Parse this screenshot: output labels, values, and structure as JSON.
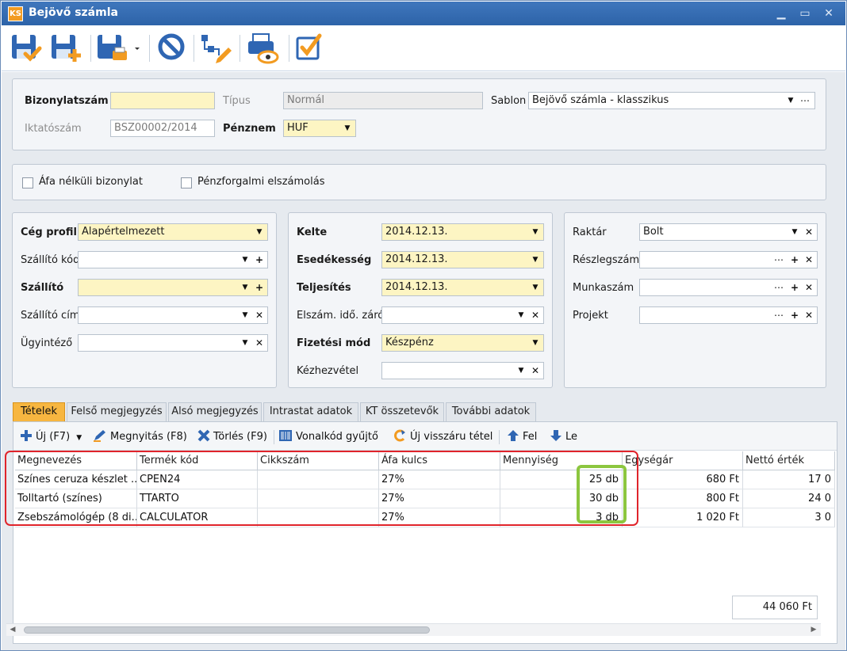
{
  "window": {
    "title": "Bejövő számla",
    "logo": "KS"
  },
  "toolbar": {
    "icons": [
      "save-check-icon",
      "save-new-icon",
      "save-print-icon",
      "cancel-icon",
      "workflow-icon",
      "print-preview-icon",
      "approve-icon"
    ]
  },
  "header": {
    "bizonylatszam": {
      "label": "Bizonylatszám",
      "value": ""
    },
    "tipus": {
      "label": "Típus",
      "value": "Normál"
    },
    "sablon": {
      "label": "Sablon",
      "value": "Bejövő számla - klasszikus"
    },
    "iktatoszam": {
      "label": "Iktatószám",
      "value": "BSZ00002/2014"
    },
    "penznem": {
      "label": "Pénznem",
      "value": "HUF"
    }
  },
  "options": {
    "afa_nelkuli": {
      "label": "Áfa nélküli bizonylat",
      "checked": false
    },
    "penzforgalmi": {
      "label": "Pénzforgalmi elszámolás",
      "checked": false
    }
  },
  "left": {
    "ceg_profil": {
      "label": "Cég profil",
      "value": "Alapértelmezett"
    },
    "szallito_kod": {
      "label": "Szállító kód",
      "value": ""
    },
    "szallito": {
      "label": "Szállító",
      "value": ""
    },
    "szallito_cim": {
      "label": "Szállító cím",
      "value": ""
    },
    "ugyintezo": {
      "label": "Ügyintéző",
      "value": ""
    }
  },
  "middle": {
    "kelte": {
      "label": "Kelte",
      "value": "2014.12.13."
    },
    "esedekesseg": {
      "label": "Esedékesség",
      "value": "2014.12.13."
    },
    "teljesites": {
      "label": "Teljesítés",
      "value": "2014.12.13."
    },
    "elszam": {
      "label": "Elszám. idő. záró",
      "value": ""
    },
    "fizetesi_mod": {
      "label": "Fizetési mód",
      "value": "Készpénz"
    },
    "kezhezvetel": {
      "label": "Kézhezvétel",
      "value": ""
    }
  },
  "right": {
    "raktar": {
      "label": "Raktár",
      "value": "Bolt"
    },
    "reszlegszam": {
      "label": "Részlegszám",
      "value": ""
    },
    "munkaszam": {
      "label": "Munkaszám",
      "value": ""
    },
    "projekt": {
      "label": "Projekt",
      "value": ""
    }
  },
  "tabs": [
    "Tételek",
    "Felső megjegyzés",
    "Alsó megjegyzés",
    "Intrastat adatok",
    "KT összetevők",
    "További adatok"
  ],
  "grid_toolbar": {
    "new": "Új (F7)",
    "open": "Megnyitás (F8)",
    "delete": "Törlés (F9)",
    "barcode": "Vonalkód gyűjtő",
    "return": "Új visszáru tétel",
    "up": "Fel",
    "down": "Le"
  },
  "grid": {
    "columns": [
      "Megnevezés",
      "Termék kód",
      "Cikkszám",
      "Áfa kulcs",
      "Mennyiség",
      "Egységár",
      "Nettó érték"
    ],
    "rows": [
      [
        "Színes ceruza készlet ...",
        "CPEN24",
        "",
        "27%",
        "25 db",
        "680 Ft",
        "17 0"
      ],
      [
        "Tolltartó (színes)",
        "TTARTO",
        "",
        "27%",
        "30 db",
        "800 Ft",
        "24 0"
      ],
      [
        "Zsebszámológép (8 di...",
        "CALCULATOR",
        "",
        "27%",
        "3 db",
        "1 020 Ft",
        "3 0"
      ]
    ],
    "total": "44 060 Ft"
  },
  "colors": {
    "accent_tab": "#f7b640",
    "title_bar": "#2d63a8",
    "required_field": "#fdf5c3",
    "highlight_red": "#e0242b",
    "highlight_green": "#8cc63f"
  }
}
